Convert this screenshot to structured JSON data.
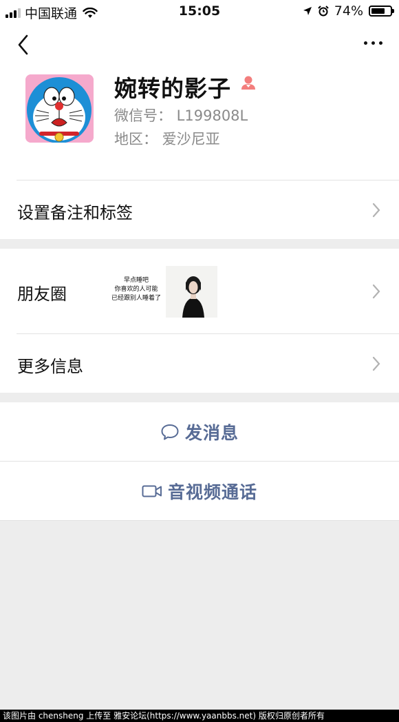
{
  "status_bar": {
    "carrier": "中国联通",
    "time": "15:05",
    "battery_percent": "74%",
    "battery_level": 0.74,
    "icons": [
      "signal-icon",
      "wifi-icon",
      "location-arrow-icon",
      "alarm-icon",
      "battery-icon"
    ]
  },
  "nav": {
    "icons": [
      "back-icon",
      "more-icon"
    ]
  },
  "profile": {
    "name": "婉转的影子",
    "wechat_id": "微信号：  L199808L",
    "region": "地区：  爱沙尼亚",
    "gender_icon": "female-icon",
    "gender_color": "#f37e7d"
  },
  "rows": {
    "remark": "设置备注和标签",
    "moments": "朋友圈",
    "moments_text_lines": [
      "早点睡吧",
      "你喜欢的人可能",
      "已经跟别人睡着了"
    ],
    "more_info": "更多信息"
  },
  "actions": {
    "message": "发消息",
    "video_call": "音视频通话",
    "link_color": "#576b95"
  },
  "watermark": "该图片由 chensheng 上传至 雅安论坛(https://www.yaanbbs.net) 版权归原创者所有"
}
